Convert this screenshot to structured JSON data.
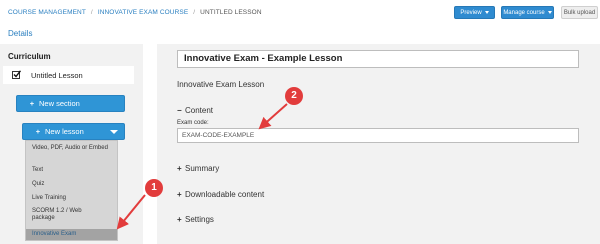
{
  "breadcrumb": {
    "items": [
      "COURSE MANAGEMENT",
      "INNOVATIVE EXAM COURSE"
    ],
    "current": "UNTITLED LESSON",
    "separator": "/"
  },
  "toolbar": {
    "preview_label": "Preview",
    "manage_label": "Manage course",
    "bulk_label": "Bulk upload"
  },
  "nav": {
    "details_label": "Details"
  },
  "sidebar": {
    "title": "Curriculum",
    "lesson_item": "Untitled Lesson",
    "new_section_label": "New section",
    "new_lesson_label": "New lesson",
    "plus_glyph": "+",
    "lesson_types": [
      "Video, PDF, Audio or Embed",
      "Text",
      "Quiz",
      "Live Training",
      "SCORM 1.2 / Web package",
      "Innovative Exam"
    ],
    "selected_type": "Innovative Exam"
  },
  "main": {
    "title_value": "Innovative Exam - Example Lesson",
    "subtitle": "Innovative Exam Lesson",
    "content_header": "Content",
    "collapse_glyph": "−",
    "expand_glyph": "+",
    "exam_code_label": "Exam code:",
    "exam_code_value": "EXAM-CODE-EXAMPLE",
    "summary_header": "Summary",
    "downloadable_header": "Downloadable content",
    "settings_header": "Settings"
  },
  "annotations": {
    "callout_1": "1",
    "callout_2": "2"
  },
  "colors": {
    "accent": "#2f95d6",
    "link": "#2a7fc0",
    "callout": "#e23c3c",
    "panel_bg": "#f2f2f2"
  }
}
